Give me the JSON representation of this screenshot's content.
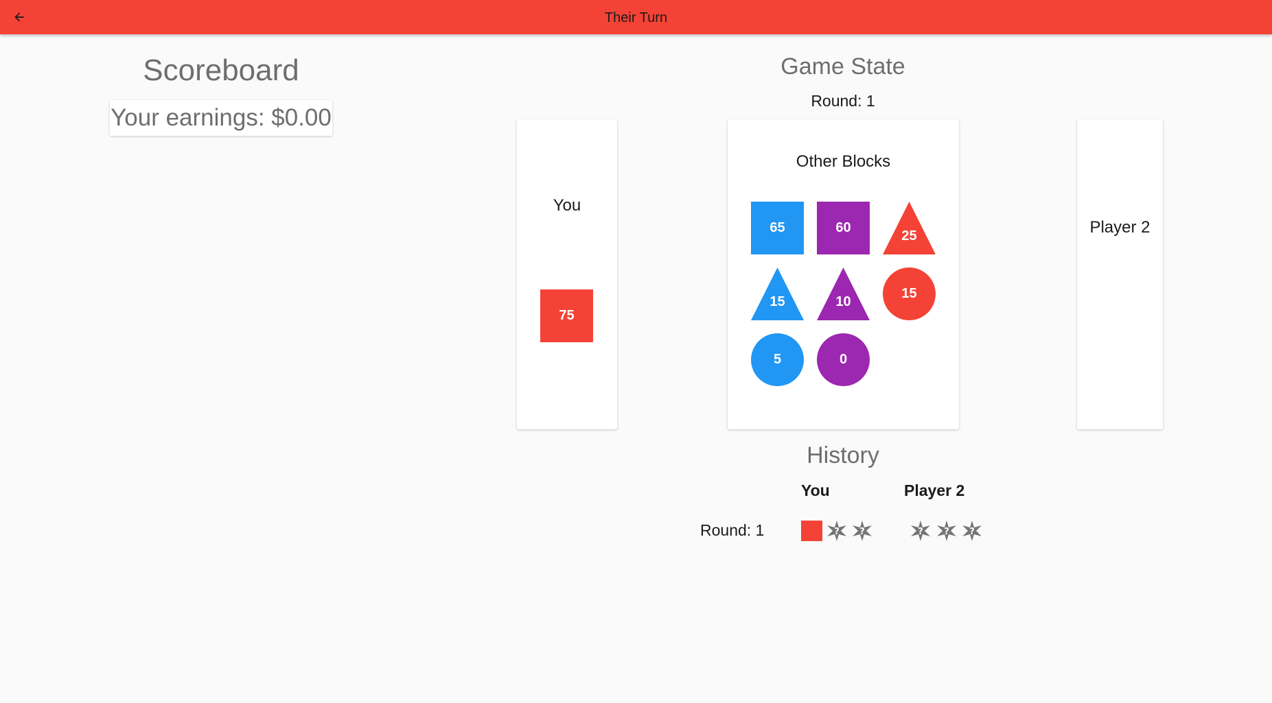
{
  "appbar": {
    "title": "Their Turn",
    "back_icon": "arrow-back-icon",
    "color": "#f44336"
  },
  "scoreboard": {
    "title": "Scoreboard",
    "earnings": "Your earnings: $0.00"
  },
  "game_state": {
    "title": "Game State",
    "round": "Round: 1",
    "you_label": "You",
    "you_block": {
      "value": "75",
      "shape": "square",
      "color": "#f44336"
    },
    "other_title": "Other Blocks",
    "other_blocks": [
      {
        "value": "65",
        "shape": "square",
        "color": "#2196f3"
      },
      {
        "value": "60",
        "shape": "square",
        "color": "#9c27b0"
      },
      {
        "value": "25",
        "shape": "triangle",
        "color": "#f44336"
      },
      {
        "value": "15",
        "shape": "triangle",
        "color": "#2196f3"
      },
      {
        "value": "10",
        "shape": "triangle",
        "color": "#9c27b0"
      },
      {
        "value": "15",
        "shape": "circle",
        "color": "#f44336"
      },
      {
        "value": "5",
        "shape": "circle",
        "color": "#2196f3"
      },
      {
        "value": "0",
        "shape": "circle",
        "color": "#9c27b0"
      }
    ],
    "player2_label": "Player 2"
  },
  "history": {
    "title": "History",
    "you_header": "You",
    "player2_header": "Player 2",
    "rows": [
      {
        "round": "Round: 1",
        "you": [
          "red-square",
          "hidden-block-icon",
          "hidden-block-icon"
        ],
        "player2": [
          "hidden-block-icon",
          "hidden-block-icon",
          "hidden-block-icon"
        ]
      }
    ]
  }
}
